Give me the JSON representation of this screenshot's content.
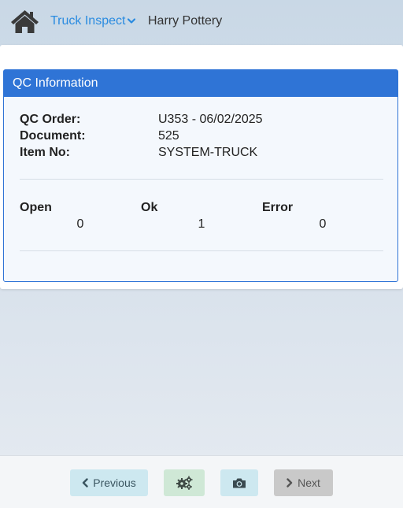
{
  "header": {
    "home_icon": "home-icon",
    "app_title": "Truck Inspect",
    "user_name": "Harry Pottery",
    "accent": "#2a8be0"
  },
  "card": {
    "title": "QC Information",
    "header_color": "#2f74d6",
    "fields": [
      {
        "label": "QC Order:",
        "value": "U353 - 06/02/2025"
      },
      {
        "label": "Document:",
        "value": "525"
      },
      {
        "label": "Item No:",
        "value": "SYSTEM-TRUCK"
      }
    ],
    "stats": [
      {
        "label": "Open",
        "value": "0"
      },
      {
        "label": "Ok",
        "value": "1"
      },
      {
        "label": "Error",
        "value": "0"
      }
    ]
  },
  "footer": {
    "previous_label": "Previous",
    "next_label": "Next",
    "settings_icon": "gears-icon",
    "camera_icon": "camera-icon"
  }
}
